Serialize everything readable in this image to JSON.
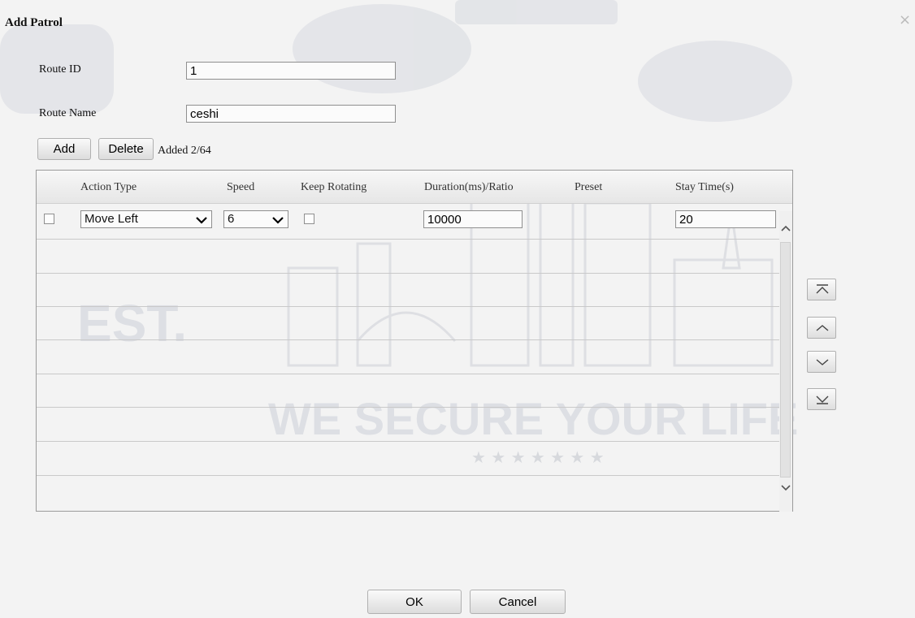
{
  "dialog": {
    "title": "Add Patrol",
    "close_glyph": "×"
  },
  "form": {
    "route_id_label": "Route ID",
    "route_id_value": "1",
    "route_name_label": "Route Name",
    "route_name_value": "ceshi"
  },
  "toolbar": {
    "add_label": "Add",
    "delete_label": "Delete",
    "count_text": "Added 2/64"
  },
  "table": {
    "columns": [
      "Action Type",
      "Speed",
      "Keep Rotating",
      "Duration(ms)/Ratio",
      "Preset",
      "Stay Time(s)"
    ],
    "rows": [
      {
        "action_type": "Move Left",
        "speed": "6",
        "duration": "10000",
        "stay_time": "20"
      }
    ]
  },
  "side_buttons": [
    {
      "icon": "move-to-top-icon"
    },
    {
      "icon": "move-up-icon"
    },
    {
      "icon": "move-down-icon"
    },
    {
      "icon": "move-to-bottom-icon"
    }
  ],
  "footer": {
    "ok_label": "OK",
    "cancel_label": "Cancel"
  },
  "watermark": {
    "line1": "EST.",
    "line2": "WE SECURE YOUR LIFE",
    "stars": "★ ★ ★ ★ ★ ★ ★"
  }
}
